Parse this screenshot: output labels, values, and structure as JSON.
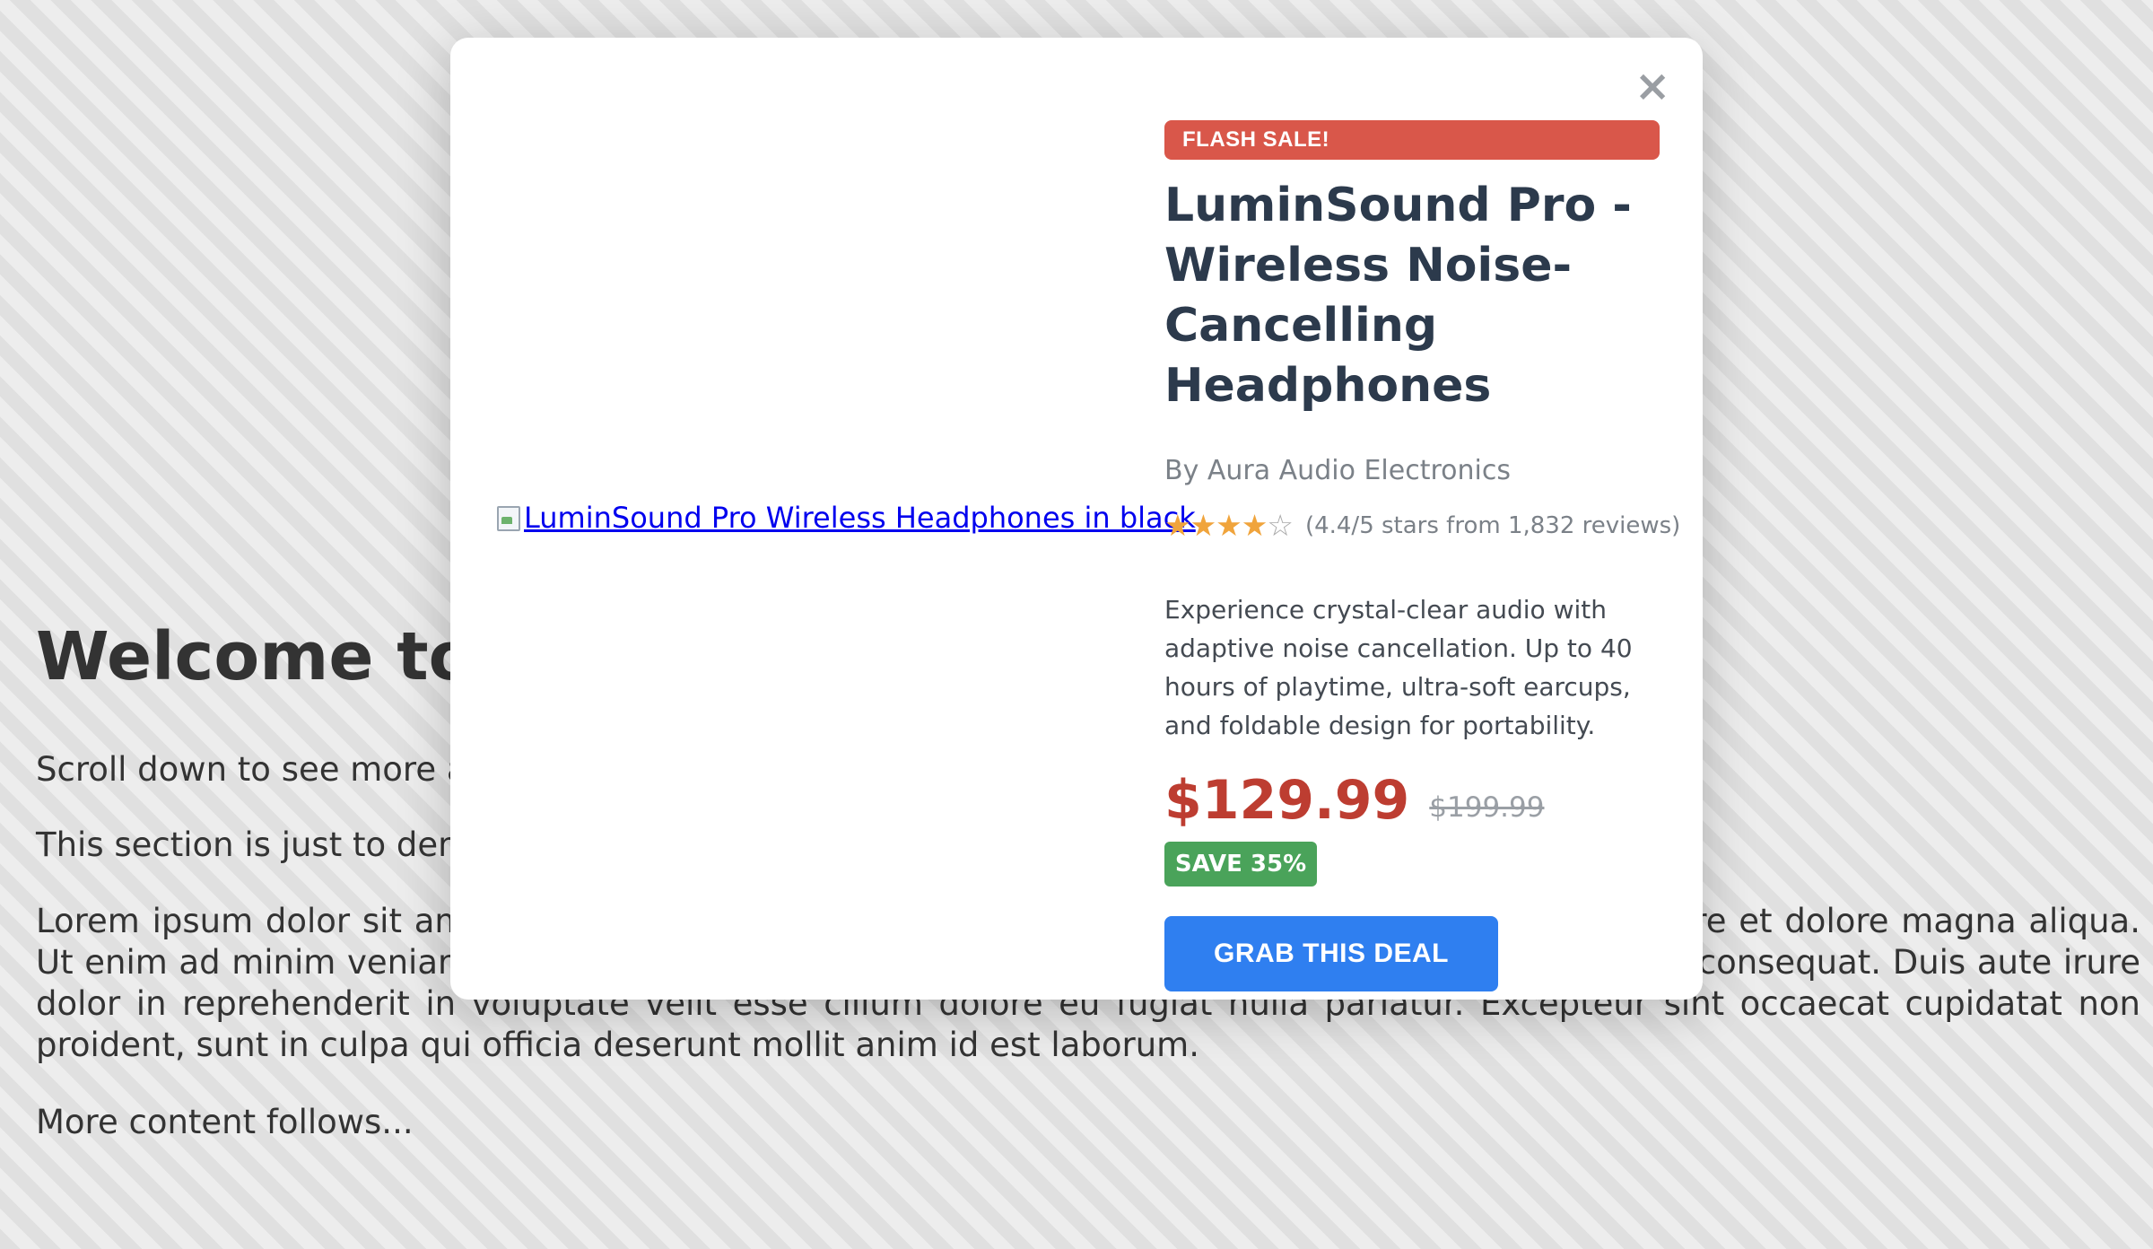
{
  "page": {
    "heading": "Welcome to",
    "paragraphs": {
      "p1": "Scroll down to see more an",
      "p2": "This section is just to demo",
      "p3": "Lorem ipsum dolor sit amet, consectetur adipiscing elit, sed do eiusmod tempor incididunt ut labore et dolore magna aliqua. Ut enim ad minim veniam, quis nostrud exercitation ullamco laboris nisi ut aliquip ex ea commodo consequat. Duis aute irure dolor in reprehenderit in voluptate velit esse cillum dolore eu fugiat nulla pariatur. Excepteur sint occaecat cupidatat non proident, sunt in culpa qui officia deserunt mollit anim id est laborum.",
      "p4": "More content follows..."
    }
  },
  "modal": {
    "close_label": "×",
    "image_alt": "LuminSound Pro Wireless Headphones in black",
    "badge": "FLASH SALE!",
    "title": "LuminSound Pro - Wireless Noise-Cancelling Headphones",
    "brand": "By Aura Audio Electronics",
    "rating": {
      "value": 4.4,
      "max": 5,
      "stars_filled": "★★★★",
      "stars_empty": "☆",
      "text": "(4.4/5 stars from 1,832 reviews)"
    },
    "description": "Experience crystal-clear audio with adaptive noise cancellation. Up to 40 hours of playtime, ultra-soft earcups, and foldable design for portability.",
    "price": {
      "current": "$129.99",
      "original": "$199.99",
      "save_badge": "SAVE 35%"
    },
    "cta": "GRAB THIS DEAL"
  },
  "colors": {
    "flash_badge": "#d9574a",
    "title": "#2c3a4c",
    "price": "#bd3d31",
    "save_badge": "#4aa35a",
    "cta": "#2f7ff0",
    "stars": "#f0a43c"
  }
}
